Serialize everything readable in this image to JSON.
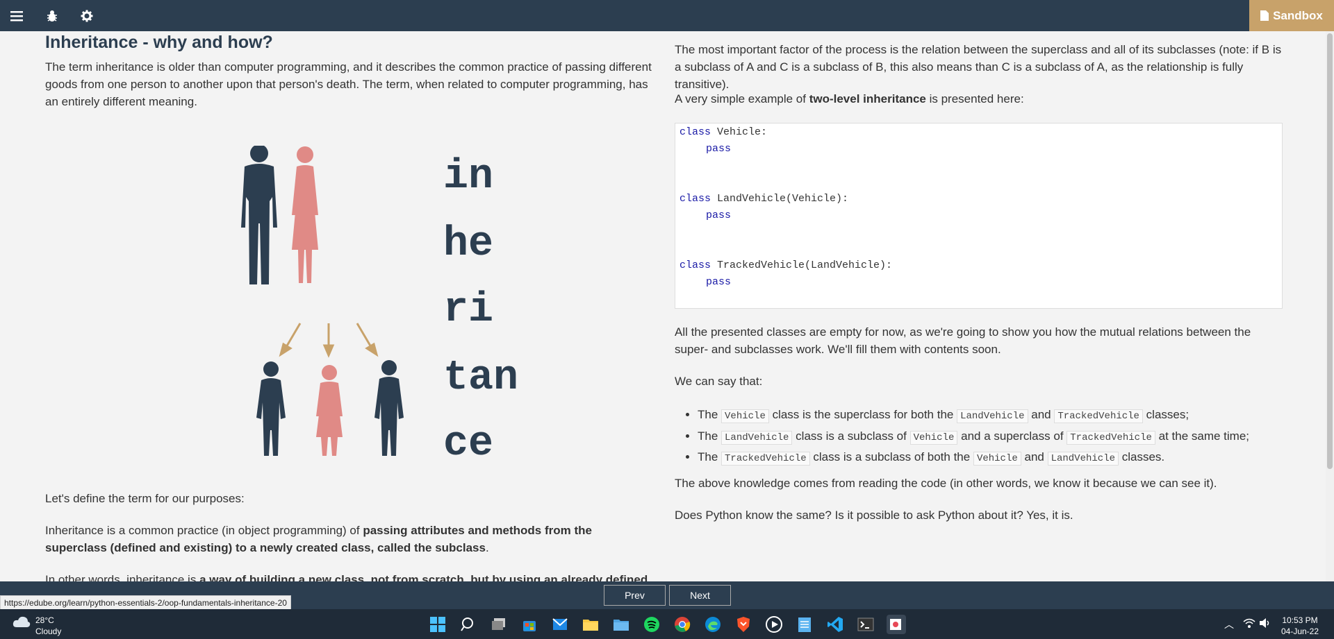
{
  "header": {
    "sandbox_label": "Sandbox"
  },
  "left": {
    "title": "Inheritance - why and how?",
    "intro": "The term inheritance is older than computer programming, and it describes the common practice of passing different goods from one person to another upon that person's death. The term, when related to computer programming, has an entirely different meaning.",
    "illustration_word": [
      "in",
      "he",
      "ri",
      "tan",
      "ce"
    ],
    "define": "Let's define the term for our purposes:",
    "p2_a": "Inheritance is a common practice (in object programming) of ",
    "p2_b": "passing attributes and methods from the superclass (defined and existing) to a newly created class, called the subclass",
    "p2_c": ".",
    "p3_a": "In other words, inheritance is ",
    "p3_b": "a way of building a new class, not from scratch, but by using an already defined"
  },
  "right": {
    "p1": "The most important factor of the process is the relation between the superclass and all of its subclasses (note: if B is a subclass of A and C is a subclass of B, this also means than C is a subclass of A, as the relationship is fully transitive).",
    "p2_a": "A very simple example of ",
    "p2_b": "two-level inheritance",
    "p2_c": " is presented here:",
    "code": {
      "kw_class": "class",
      "kw_pass": "pass",
      "c1": " Vehicle:",
      "c2": " LandVehicle(Vehicle):",
      "c3": " TrackedVehicle(LandVehicle):"
    },
    "p3": "All the presented classes are empty for now, as we're going to show you how the mutual relations between the super- and subclasses work. We'll fill them with contents soon.",
    "p4": "We can say that:",
    "bullets": {
      "the": "The",
      "b1": {
        "code1": "Vehicle",
        "t1": " class is the superclass for both the ",
        "code2": "LandVehicle",
        "t2": " and ",
        "code3": "TrackedVehicle",
        "t3": " classes;"
      },
      "b2": {
        "code1": "LandVehicle",
        "t1": " class is a subclass of ",
        "code2": "Vehicle",
        "t2": " and a superclass of ",
        "code3": "TrackedVehicle",
        "t3": " at the same time;"
      },
      "b3": {
        "code1": "TrackedVehicle",
        "t1": " class is a subclass of both the ",
        "code2": "Vehicle",
        "t2": " and ",
        "code3": "LandVehicle",
        "t3": " classes."
      }
    },
    "p5": "The above knowledge comes from reading the code (in other words, we know it because we can see it).",
    "p6": "Does Python know the same? Is it possible to ask Python about it? Yes, it is."
  },
  "nav": {
    "prev": "Prev",
    "next": "Next"
  },
  "status_url": "https://edube.org/learn/python-essentials-2/oop-fundamentals-inheritance-20",
  "taskbar": {
    "temp": "28°C",
    "weather": "Cloudy",
    "time": "10:53 PM",
    "date": "04-Jun-22"
  },
  "colors": {
    "navy": "#2c3e50",
    "pink": "#e08a86",
    "gold": "#c8a26a",
    "keyword": "#1a1aa6"
  }
}
